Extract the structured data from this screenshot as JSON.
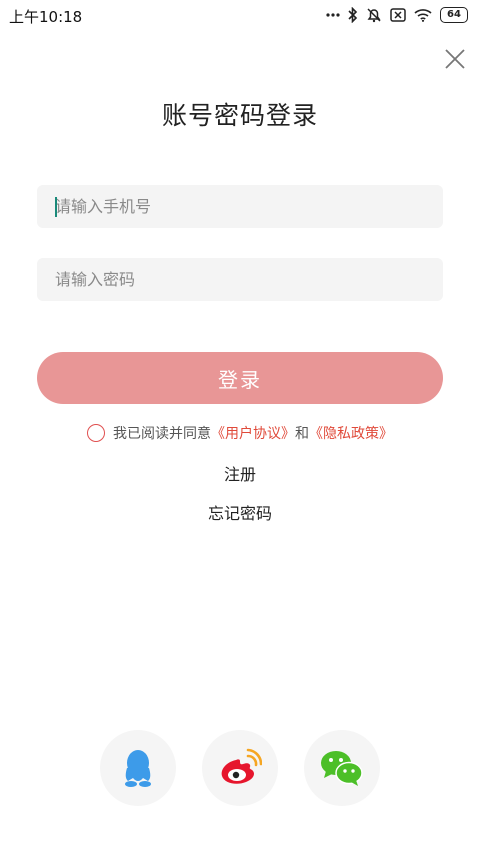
{
  "status_bar": {
    "time": "上午10:18",
    "battery": "64"
  },
  "header": {
    "title": "账号密码登录"
  },
  "form": {
    "phone_placeholder": "请输入手机号",
    "password_placeholder": "请输入密码",
    "login_label": "登录"
  },
  "agreement": {
    "prefix": "我已阅读并同意",
    "user_agreement": "《用户协议》",
    "conjunction": "和",
    "privacy_policy": "《隐私政策》"
  },
  "links": {
    "register": "注册",
    "forgot_password": "忘记密码"
  },
  "social": [
    "qq-icon",
    "weibo-icon",
    "wechat-icon"
  ],
  "colors": {
    "login_button": "#e89696",
    "link_red": "#e04a3a",
    "qq_blue": "#3d9be9",
    "weibo_red": "#e6162d",
    "wechat_green": "#4cbf28"
  }
}
